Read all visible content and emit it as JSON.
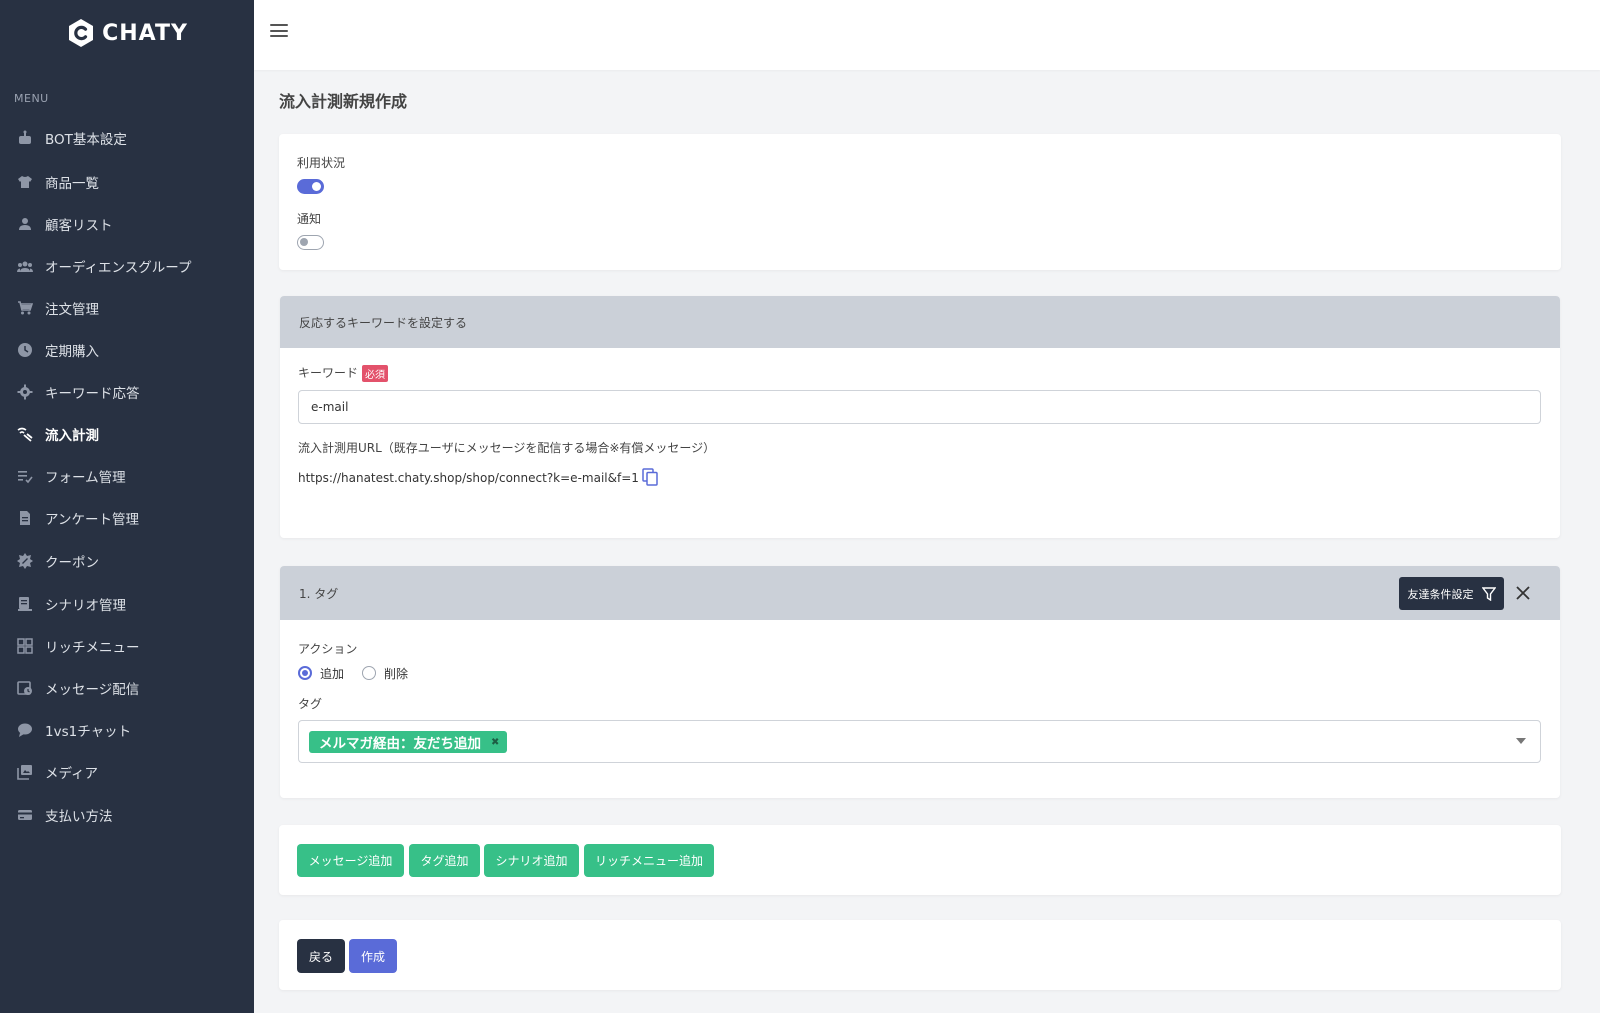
{
  "app": {
    "name": "CHATY"
  },
  "sidebar": {
    "menu_heading": "MENU",
    "items": [
      {
        "label": "BOT基本設定",
        "icon": "robot-icon"
      },
      {
        "label": "商品一覧",
        "icon": "shirt-icon"
      },
      {
        "label": "顧客リスト",
        "icon": "person-icon"
      },
      {
        "label": "オーディエンスグループ",
        "icon": "group-icon"
      },
      {
        "label": "注文管理",
        "icon": "cart-icon"
      },
      {
        "label": "定期購入",
        "icon": "clock-icon"
      },
      {
        "label": "キーワード応答",
        "icon": "gear-icon"
      },
      {
        "label": "流入計測",
        "icon": "signal-icon",
        "active": true
      },
      {
        "label": "フォーム管理",
        "icon": "checklist-icon"
      },
      {
        "label": "アンケート管理",
        "icon": "document-icon"
      },
      {
        "label": "クーポン",
        "icon": "badge-icon"
      },
      {
        "label": "シナリオ管理",
        "icon": "scenario-icon"
      },
      {
        "label": "リッチメニュー",
        "icon": "grid-icon"
      },
      {
        "label": "メッセージ配信",
        "icon": "broadcast-icon"
      },
      {
        "label": "1vs1チャット",
        "icon": "chat-icon"
      },
      {
        "label": "メディア",
        "icon": "media-icon"
      },
      {
        "label": "支払い方法",
        "icon": "card-icon"
      }
    ]
  },
  "page": {
    "title": "流入計測新規作成"
  },
  "status_card": {
    "usage_label": "利用状況",
    "usage_on": true,
    "notify_label": "通知",
    "notify_on": false
  },
  "keyword_card": {
    "header": "反応するキーワードを設定する",
    "keyword_label": "キーワード",
    "required_badge": "必須",
    "keyword_value": "e-mail",
    "url_label": "流入計測用URL（既存ユーザにメッセージを配信する場合※有償メッセージ）",
    "url_value": "https://hanatest.chaty.shop/shop/connect?k=e-mail&f=1"
  },
  "tag_card": {
    "header": "1. タグ",
    "filter_button": "友達条件設定",
    "action_label": "アクション",
    "action_options": [
      {
        "label": "追加",
        "checked": true
      },
      {
        "label": "削除",
        "checked": false
      }
    ],
    "tag_label": "タグ",
    "selected_tag": "メルマガ経由：友だち追加"
  },
  "add_buttons": {
    "message": "メッセージ追加",
    "tag": "タグ追加",
    "scenario": "シナリオ追加",
    "richmenu": "リッチメニュー追加"
  },
  "footer_buttons": {
    "back": "戻る",
    "create": "作成"
  },
  "colors": {
    "sidebar_bg": "#283142",
    "accent_blue": "#5a6bd8",
    "accent_green": "#37c088",
    "required_red": "#e3526b"
  }
}
